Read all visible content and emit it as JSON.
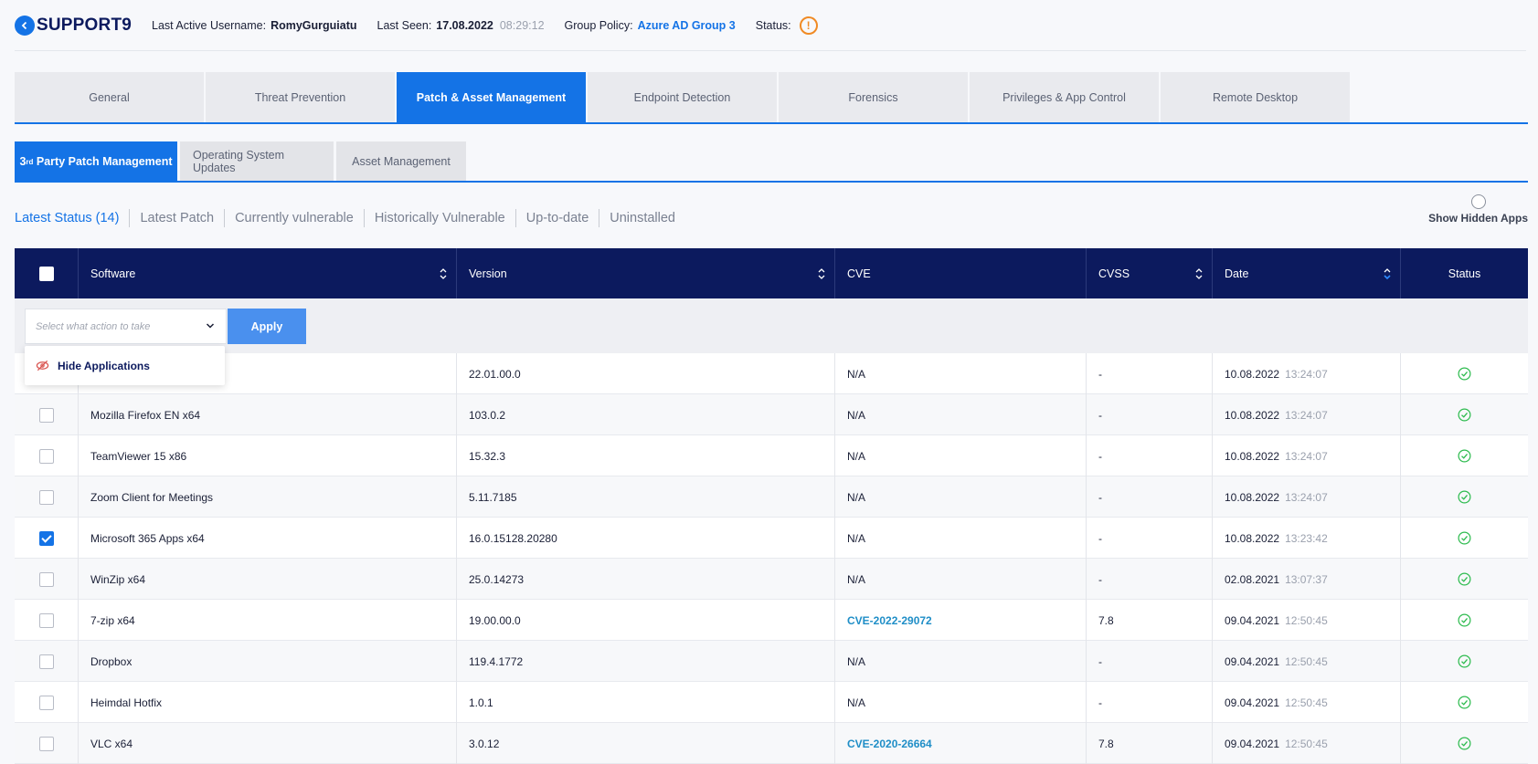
{
  "header": {
    "device_name": "SUPPORT9",
    "last_active_label": "Last Active Username:",
    "last_active_value": "RomyGurguiatu",
    "last_seen_label": "Last Seen:",
    "last_seen_date": "17.08.2022",
    "last_seen_time": "08:29:12",
    "group_policy_label": "Group Policy:",
    "group_policy_value": "Azure AD Group 3",
    "status_label": "Status:",
    "status_icon": "warning-icon",
    "status_symbol": "!"
  },
  "main_tabs": [
    {
      "label": "General",
      "active": false
    },
    {
      "label": "Threat Prevention",
      "active": false
    },
    {
      "label": "Patch & Asset Management",
      "active": true
    },
    {
      "label": "Endpoint Detection",
      "active": false
    },
    {
      "label": "Forensics",
      "active": false
    },
    {
      "label": "Privileges & App Control",
      "active": false
    },
    {
      "label": "Remote Desktop",
      "active": false
    }
  ],
  "sub_tabs": {
    "third_party_prefix": "3",
    "third_party_sup": "rd",
    "third_party_rest": " Party Patch Management",
    "os_updates": "Operating System Updates",
    "asset_management": "Asset Management"
  },
  "filters": [
    {
      "label": "Latest Status (14)",
      "active": true
    },
    {
      "label": "Latest Patch",
      "active": false
    },
    {
      "label": "Currently vulnerable",
      "active": false
    },
    {
      "label": "Historically Vulnerable",
      "active": false
    },
    {
      "label": "Up-to-date",
      "active": false
    },
    {
      "label": "Uninstalled",
      "active": false
    }
  ],
  "show_hidden_apps_label": "Show Hidden Apps",
  "table": {
    "columns": {
      "software": "Software",
      "version": "Version",
      "cve": "CVE",
      "cvss": "CVSS",
      "date": "Date",
      "status": "Status"
    },
    "action_placeholder": "Select what action to take",
    "apply_label": "Apply",
    "menu_item": "Hide Applications",
    "rows": [
      {
        "software": "",
        "version": "22.01.00.0",
        "cve": "N/A",
        "cvss": "-",
        "date": "10.08.2022",
        "time": "13:24:07",
        "checked": false
      },
      {
        "software": "Mozilla Firefox EN x64",
        "version": "103.0.2",
        "cve": "N/A",
        "cvss": "-",
        "date": "10.08.2022",
        "time": "13:24:07",
        "checked": false
      },
      {
        "software": "TeamViewer 15 x86",
        "version": "15.32.3",
        "cve": "N/A",
        "cvss": "-",
        "date": "10.08.2022",
        "time": "13:24:07",
        "checked": false
      },
      {
        "software": "Zoom Client for Meetings",
        "version": "5.11.7185",
        "cve": "N/A",
        "cvss": "-",
        "date": "10.08.2022",
        "time": "13:24:07",
        "checked": false
      },
      {
        "software": "Microsoft 365 Apps x64",
        "version": "16.0.15128.20280",
        "cve": "N/A",
        "cvss": "-",
        "date": "10.08.2022",
        "time": "13:23:42",
        "checked": true
      },
      {
        "software": "WinZip x64",
        "version": "25.0.14273",
        "cve": "N/A",
        "cvss": "-",
        "date": "02.08.2021",
        "time": "13:07:37",
        "checked": false
      },
      {
        "software": "7-zip x64",
        "version": "19.00.00.0",
        "cve": "CVE-2022-29072",
        "cvss": "7.8",
        "date": "09.04.2021",
        "time": "12:50:45",
        "checked": false
      },
      {
        "software": "Dropbox",
        "version": "119.4.1772",
        "cve": "N/A",
        "cvss": "-",
        "date": "09.04.2021",
        "time": "12:50:45",
        "checked": false
      },
      {
        "software": "Heimdal Hotfix",
        "version": "1.0.1",
        "cve": "N/A",
        "cvss": "-",
        "date": "09.04.2021",
        "time": "12:50:45",
        "checked": false
      },
      {
        "software": "VLC x64",
        "version": "3.0.12",
        "cve": "CVE-2020-26664",
        "cvss": "7.8",
        "date": "09.04.2021",
        "time": "12:50:45",
        "checked": false
      }
    ]
  },
  "colors": {
    "accent": "#1473e6",
    "header_navy": "#0c1a5e",
    "warning": "#f08a24",
    "success": "#2dbb4e",
    "link": "#1f8ec7"
  }
}
